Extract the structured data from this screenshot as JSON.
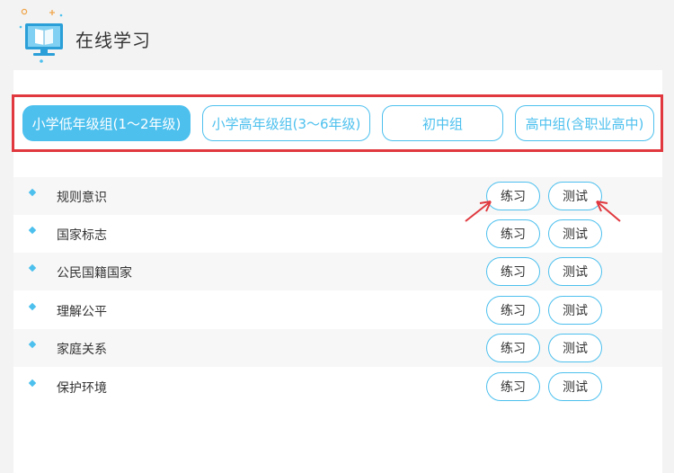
{
  "header": {
    "title": "在线学习"
  },
  "tabs": [
    {
      "label": "小学低年级组(1～2年级)",
      "active": true
    },
    {
      "label": "小学高年级组(3～6年级)",
      "active": false
    },
    {
      "label": "初中组",
      "active": false
    },
    {
      "label": "高中组(含职业高中)",
      "active": false
    }
  ],
  "lessons": [
    {
      "title": "规则意识",
      "practice_label": "练习",
      "test_label": "测试"
    },
    {
      "title": "国家标志",
      "practice_label": "练习",
      "test_label": "测试"
    },
    {
      "title": "公民国籍国家",
      "practice_label": "练习",
      "test_label": "测试"
    },
    {
      "title": "理解公平",
      "practice_label": "练习",
      "test_label": "测试"
    },
    {
      "title": "家庭关系",
      "practice_label": "练习",
      "test_label": "测试"
    },
    {
      "title": "保护环境",
      "practice_label": "练习",
      "test_label": "测试"
    }
  ],
  "colors": {
    "accent": "#4dc0ee",
    "highlight_border": "#e0383e",
    "annotation_arrow": "#e0383e"
  },
  "icons": {
    "logo": "computer-book-icon",
    "bullet": "diamond-bullet-icon",
    "annotation": "red-arrow-icon"
  }
}
